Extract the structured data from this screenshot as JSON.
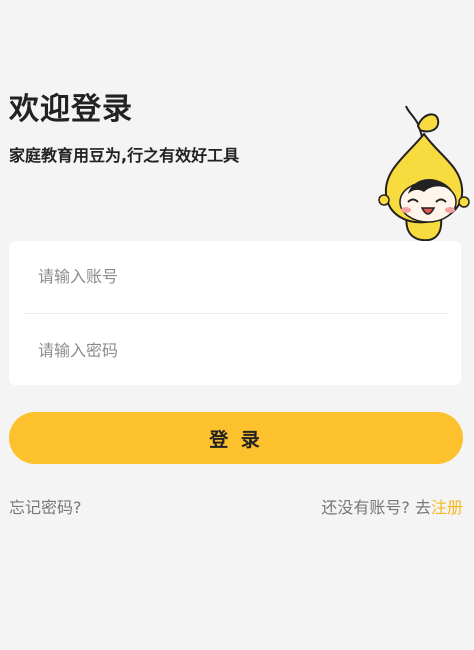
{
  "header": {
    "title": "欢迎登录",
    "subtitle": "家庭教育用豆为,行之有效好工具"
  },
  "form": {
    "account_placeholder": "请输入账号",
    "account_value": "",
    "password_placeholder": "请输入密码",
    "password_value": ""
  },
  "actions": {
    "login_label": "登 录",
    "forgot_label": "忘记密码?",
    "no_account_label": "还没有账号? 去",
    "register_label": "注册"
  },
  "icons": {
    "mascot": "bean-mascot-icon"
  },
  "colors": {
    "accent": "#fcc12c",
    "link": "#f5b81f",
    "background": "#f4f4f4"
  }
}
